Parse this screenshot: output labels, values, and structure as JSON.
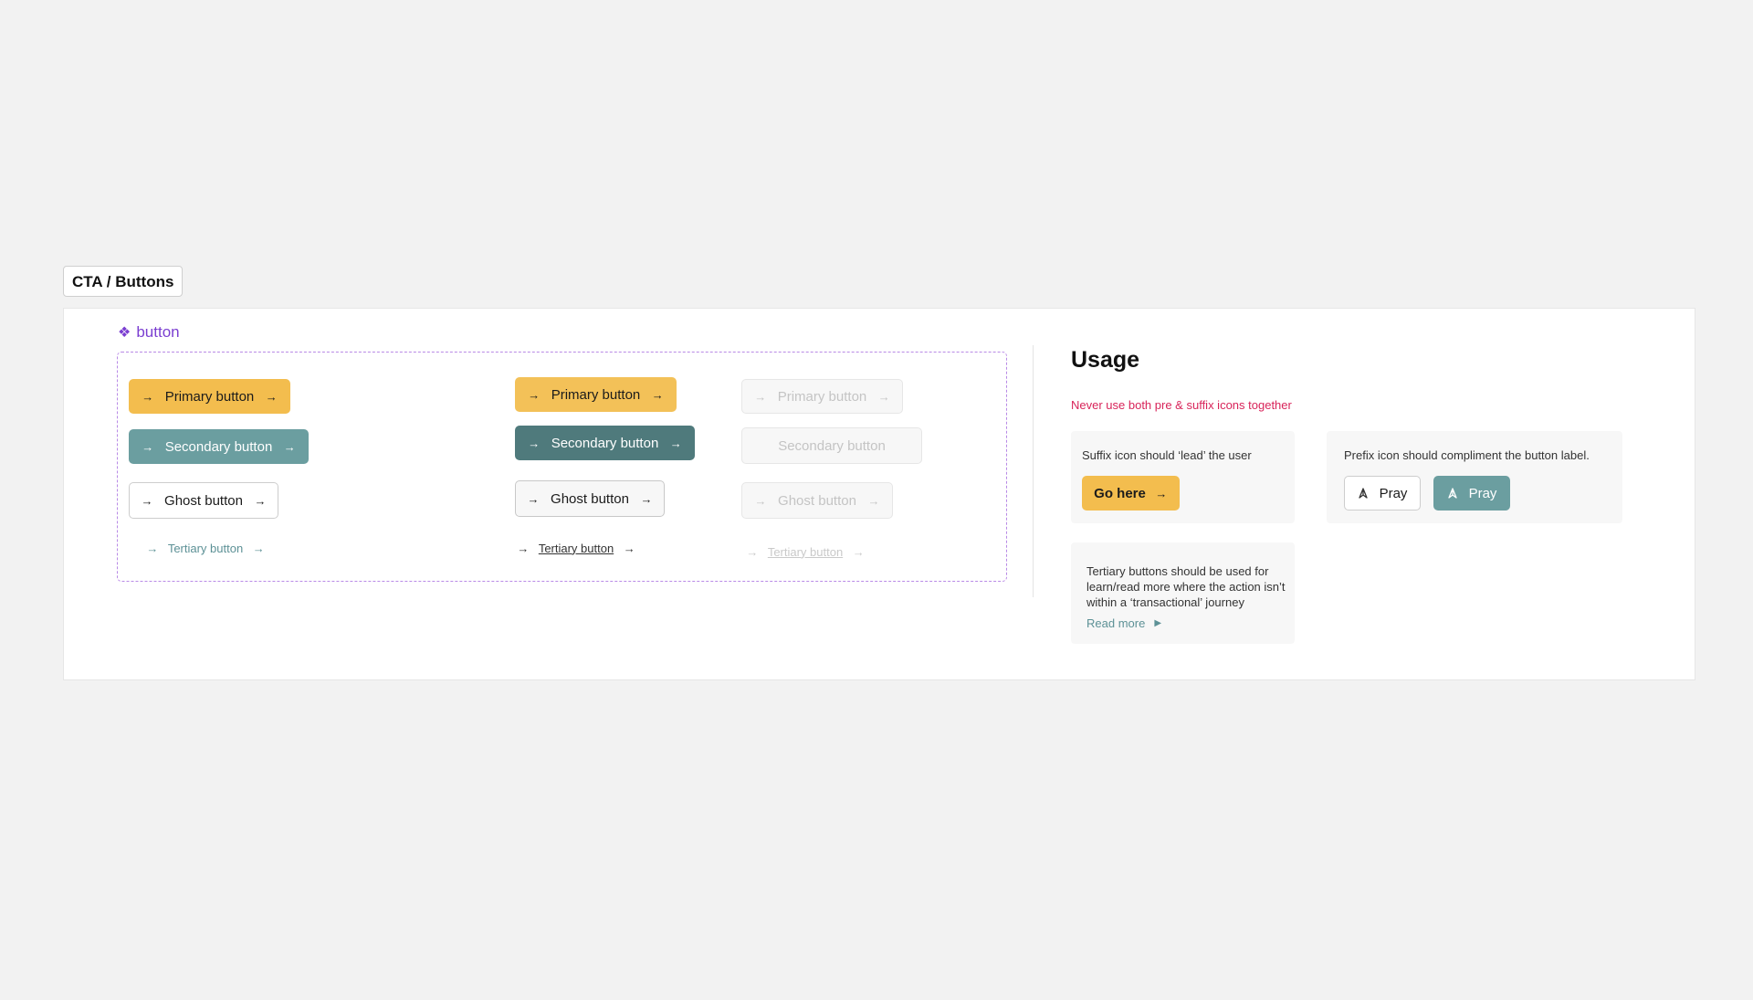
{
  "frame": {
    "title": "CTA / Buttons"
  },
  "component": {
    "icon": "component-icon",
    "label": "button"
  },
  "variants": {
    "default": {
      "primary": "Primary button",
      "secondary": "Secondary button",
      "ghost": "Ghost button",
      "tertiary": "Tertiary button"
    },
    "hover": {
      "primary": "Primary button",
      "secondary": "Secondary button",
      "ghost": "Ghost button",
      "tertiary": "Tertiary button"
    },
    "disabled": {
      "primary": "Primary button",
      "secondary": "Secondary button",
      "ghost": "Ghost button",
      "tertiary": "Tertiary button"
    }
  },
  "usage": {
    "title": "Usage",
    "warning": "Never use both pre & suffix icons together",
    "suffix_card": {
      "text": "Suffix icon should ‘lead’ the user",
      "button": "Go here"
    },
    "prefix_card": {
      "text": "Prefix icon should compliment the button label.",
      "ghost_button": "Pray",
      "secondary_button": "Pray"
    },
    "tertiary_card": {
      "text": "Tertiary buttons should be used for learn/read more where the action isn’t within a ‘transactional’ journey",
      "link": "Read more"
    }
  },
  "colors": {
    "primary": "#f3bd4e",
    "secondary": "#6b9ea0",
    "secondary_hover": "#4f7a7c",
    "component_purple": "#7b3fd1",
    "warning": "#d8245a"
  }
}
